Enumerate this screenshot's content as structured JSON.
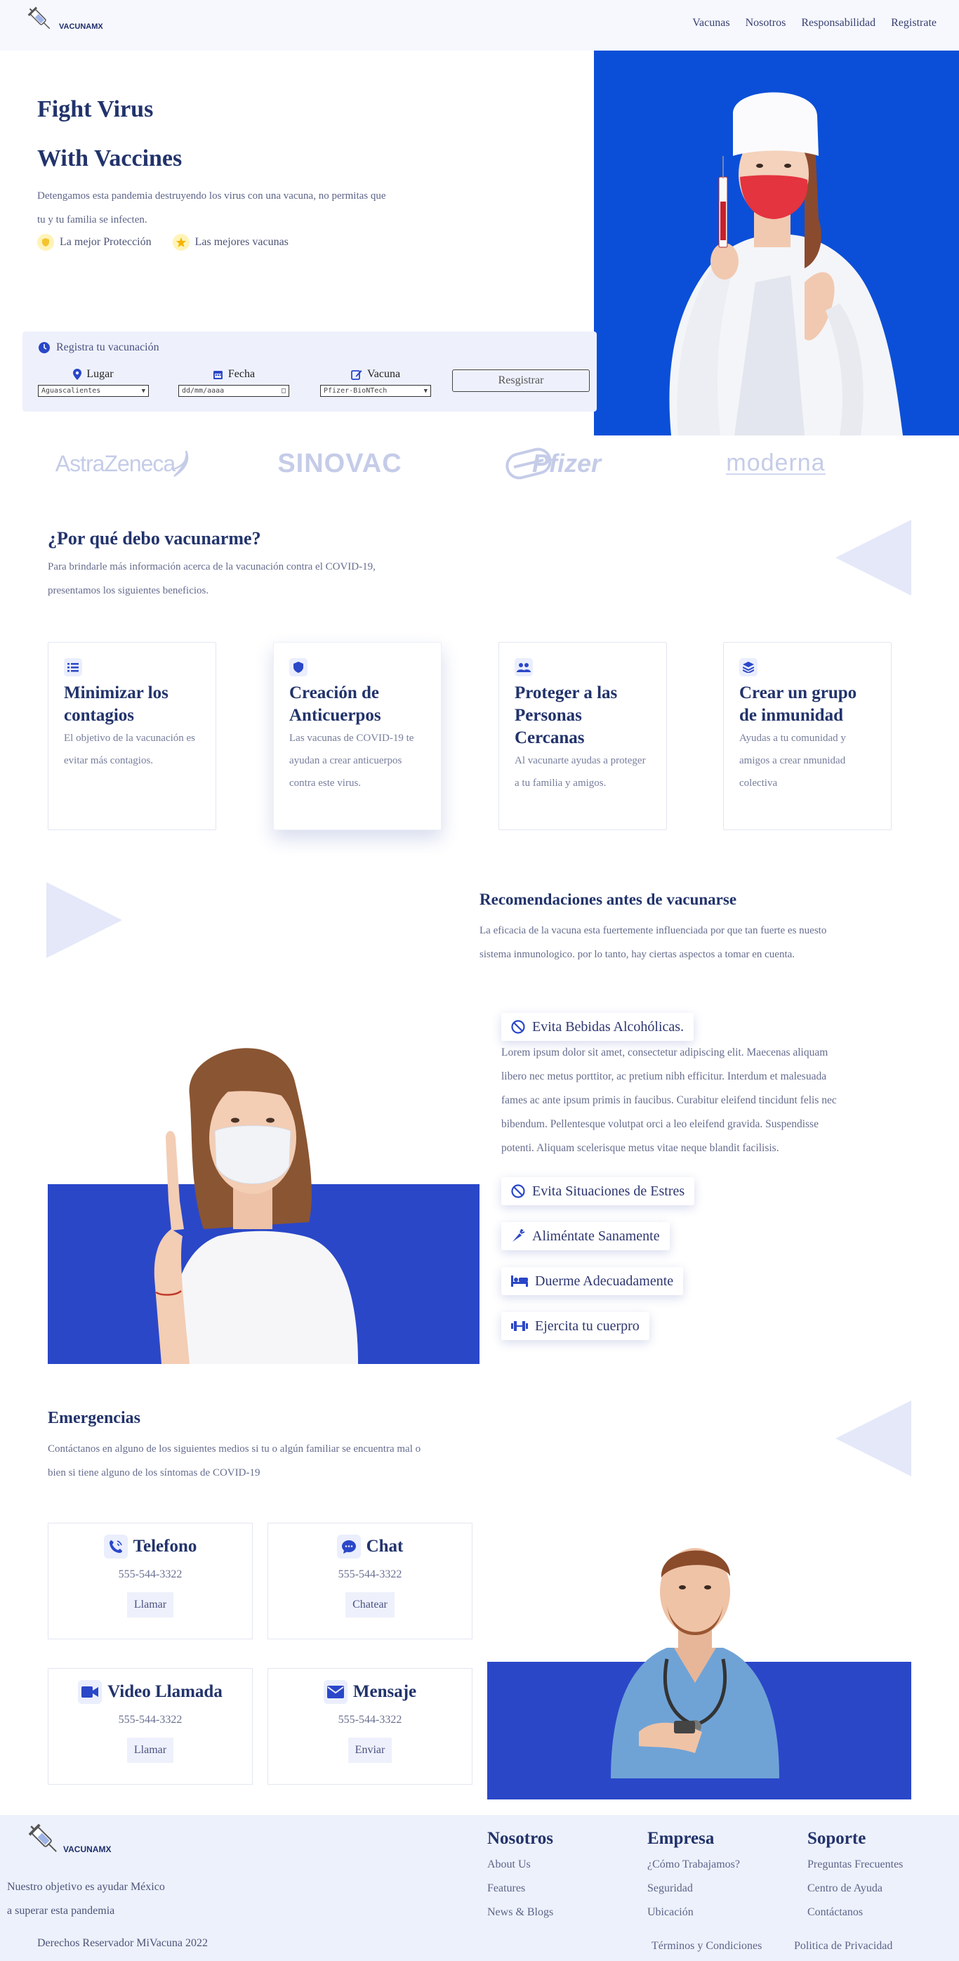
{
  "header": {
    "brand": "VACUNAMX",
    "nav": [
      "Vacunas",
      "Nosotros",
      "Responsabilidad",
      "Registrate"
    ]
  },
  "hero": {
    "title_line1": "Fight Virus",
    "title_line2": "With Vaccines",
    "subtitle_line1": "Detengamos esta pandemia destruyendo los virus con una vacuna, no permitas que",
    "subtitle_line2": "tu y tu familia se infecten.",
    "badge1": "La mejor Protección",
    "badge2": "Las mejores vacunas"
  },
  "booking": {
    "heading": "Registra tu vacunación",
    "place_label": "Lugar",
    "place_value": "Aguascalientes",
    "date_label": "Fecha",
    "date_value": "dd/mm/aaaa",
    "vaccine_label": "Vacuna",
    "vaccine_value": "Pfizer-BioNTech",
    "submit": "Resgistrar"
  },
  "brands": [
    "AstraZeneca",
    "SINOVAC",
    "Pfizer",
    "moderna"
  ],
  "why": {
    "title": "¿Por qué debo vacunarme?",
    "text_line1": "Para brindarle más información acerca de la vacunación contra el COVID-19,",
    "text_line2": "presentamos los siguientes beneficios.",
    "cards": [
      {
        "icon": "list-icon",
        "title": "Minimizar los contagios",
        "desc": "El objetivo de la vacunación es evitar más contagios."
      },
      {
        "icon": "shield-icon",
        "title": "Creación de Anticuerpos",
        "desc": "Las vacunas de COVID-19 te ayudan a crear anticuerpos contra este virus."
      },
      {
        "icon": "users-icon",
        "title": "Proteger a las Personas Cercanas",
        "desc": "Al vacunarte ayudas a proteger a tu familia y amigos."
      },
      {
        "icon": "layers-icon",
        "title": "Crear un grupo de inmunidad",
        "desc": "Ayudas a tu comunidad y amigos a crear nmunidad colectiva"
      }
    ]
  },
  "recs": {
    "title": "Recomendaciones antes de vacunarse",
    "text_line1": "La eficacia de la vacuna esta fuertemente influenciada por que tan fuerte es nuesto",
    "text_line2": "sistema inmunologico. por lo tanto, hay ciertas aspectos a tomar en cuenta.",
    "items": [
      "Evita Bebidas Alcohólicas.",
      "Evita Situaciones de Estres",
      "Aliméntate Sanamente",
      "Duerme Adecuadamente",
      "Ejercita tu cuerpro"
    ],
    "body": [
      "Lorem ipsum dolor sit amet, consectetur adipiscing elit. Maecenas aliquam",
      "libero nec metus porttitor, ac pretium nibh efficitur. Interdum et malesuada",
      "fames ac ante ipsum primis in faucibus. Curabitur eleifend tincidunt felis nec",
      "bibendum. Pellentesque volutpat orci a leo eleifend gravida. Suspendisse",
      "potenti. Aliquam scelerisque metus vitae neque blandit facilisis."
    ]
  },
  "emergency": {
    "title": "Emergencias",
    "text_line1": "Contáctanos en alguno de los siguientes medios si tu o algún familiar se encuentra mal o",
    "text_line2": "bien si tiene alguno de los síntomas de COVID-19",
    "cards": [
      {
        "title": "Telefono",
        "phone": "555-544-3322",
        "button": "Llamar"
      },
      {
        "title": "Chat",
        "phone": "555-544-3322",
        "button": "Chatear"
      },
      {
        "title": "Video Llamada",
        "phone": "555-544-3322",
        "button": "Llamar"
      },
      {
        "title": "Mensaje",
        "phone": "555-544-3322",
        "button": "Enviar"
      }
    ]
  },
  "footer": {
    "brand": "VACUNAMX",
    "tagline1": "Nuestro objetivo es ayudar México",
    "tagline2": "a superar esta pandemia",
    "copyright": "Derechos Reservador MiVacuna 2022",
    "col1": {
      "title": "Nosotros",
      "links": [
        "About Us",
        "Features",
        "News & Blogs"
      ]
    },
    "col2": {
      "title": "Empresa",
      "links": [
        "¿Cómo Trabajamos?",
        "Seguridad",
        "Ubicación"
      ]
    },
    "col3": {
      "title": "Soporte",
      "links": [
        "Preguntas Frecuentes",
        "Centro de Ayuda",
        "Contáctanos"
      ]
    },
    "legal1": "Términos y Condiciones",
    "legal2": "Politica de Privacidad"
  },
  "colors": {
    "accent": "#2a47c8",
    "navy": "#22336b",
    "hero_blue": "#0b4fd8",
    "footer_bg": "#edf1fc"
  }
}
